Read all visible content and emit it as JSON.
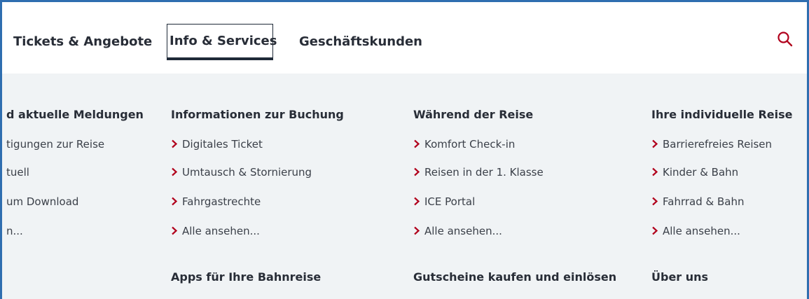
{
  "nav": {
    "items": [
      {
        "label": "Tickets & Angebote"
      },
      {
        "label": "Info & Services"
      },
      {
        "label": "Geschäftskunden"
      }
    ]
  },
  "icons": {
    "search": "search-icon",
    "chevron": "chevron-right-icon"
  },
  "colors": {
    "accent": "#b1001c",
    "text": "#282d37",
    "panel": "#f0f3f5",
    "frame": "#2f6eb0"
  },
  "menu": {
    "partial_column": {
      "title": "d aktuelle Meldungen",
      "links": [
        "tigungen zur Reise",
        "tuell",
        "um Download",
        "n..."
      ]
    },
    "columns": [
      {
        "title": "Informationen zur Buchung",
        "links": [
          "Digitales Ticket",
          "Umtausch & Stornierung",
          "Fahrgastrechte",
          "Alle ansehen..."
        ],
        "title2": "Apps für Ihre Bahnreise"
      },
      {
        "title": "Während der Reise",
        "links": [
          "Komfort Check-in",
          "Reisen in der 1. Klasse",
          "ICE Portal",
          "Alle ansehen..."
        ],
        "title2": "Gutscheine kaufen und einlösen"
      },
      {
        "title": "Ihre individuelle Reise",
        "links": [
          "Barrierefreies Reisen",
          "Kinder & Bahn",
          "Fahrrad & Bahn",
          "Alle ansehen..."
        ],
        "title2": "Über uns"
      }
    ]
  }
}
